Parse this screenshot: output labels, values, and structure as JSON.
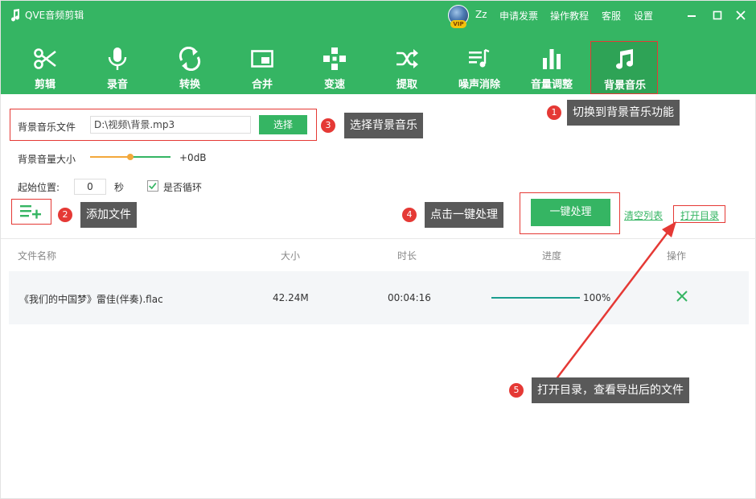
{
  "app": {
    "title": "QVE音频剪辑",
    "user_name": "Zz",
    "vip_label": "VIP"
  },
  "top_links": [
    "申请发票",
    "操作教程",
    "客服",
    "设置"
  ],
  "toolbar": {
    "items": [
      {
        "label": "剪辑",
        "icon": "scissors-icon"
      },
      {
        "label": "录音",
        "icon": "microphone-icon"
      },
      {
        "label": "转换",
        "icon": "convert-icon"
      },
      {
        "label": "合并",
        "icon": "merge-icon"
      },
      {
        "label": "变速",
        "icon": "speed-icon"
      },
      {
        "label": "提取",
        "icon": "extract-icon"
      },
      {
        "label": "噪声消除",
        "icon": "noise-removal-icon"
      },
      {
        "label": "音量调整",
        "icon": "volume-bars-icon"
      },
      {
        "label": "背景音乐",
        "icon": "music-note-icon"
      }
    ],
    "active_index": 8
  },
  "settings": {
    "bg_file_label": "背景音乐文件",
    "bg_file_value": "D:\\视频\\背景.mp3",
    "choose_button": "选择",
    "bg_volume_label": "背景音量大小",
    "bg_volume_value": "+0dB",
    "start_pos_label": "起始位置:",
    "start_pos_value": "0",
    "seconds_unit": "秒",
    "loop_label": "是否循环",
    "loop_checked": true
  },
  "actions": {
    "process_button": "一键处理",
    "clear_list": "清空列表",
    "open_dir": "打开目录"
  },
  "table": {
    "headers": [
      "文件名称",
      "大小",
      "时长",
      "进度",
      "操作"
    ],
    "rows": [
      {
        "name": "《我们的中国梦》雷佳(伴奏).flac",
        "size": "42.24M",
        "duration": "00:04:16",
        "progress": 100,
        "progress_text": "100%"
      }
    ]
  },
  "callouts": [
    {
      "num": "1",
      "text": "切换到背景音乐功能"
    },
    {
      "num": "2",
      "text": "添加文件"
    },
    {
      "num": "3",
      "text": "选择背景音乐"
    },
    {
      "num": "4",
      "text": "点击一键处理"
    },
    {
      "num": "5",
      "text": "打开目录，查看导出后的文件"
    }
  ],
  "colors": {
    "brand": "#35b563",
    "annotation": "#e53935",
    "callout_bg": "#595959"
  }
}
